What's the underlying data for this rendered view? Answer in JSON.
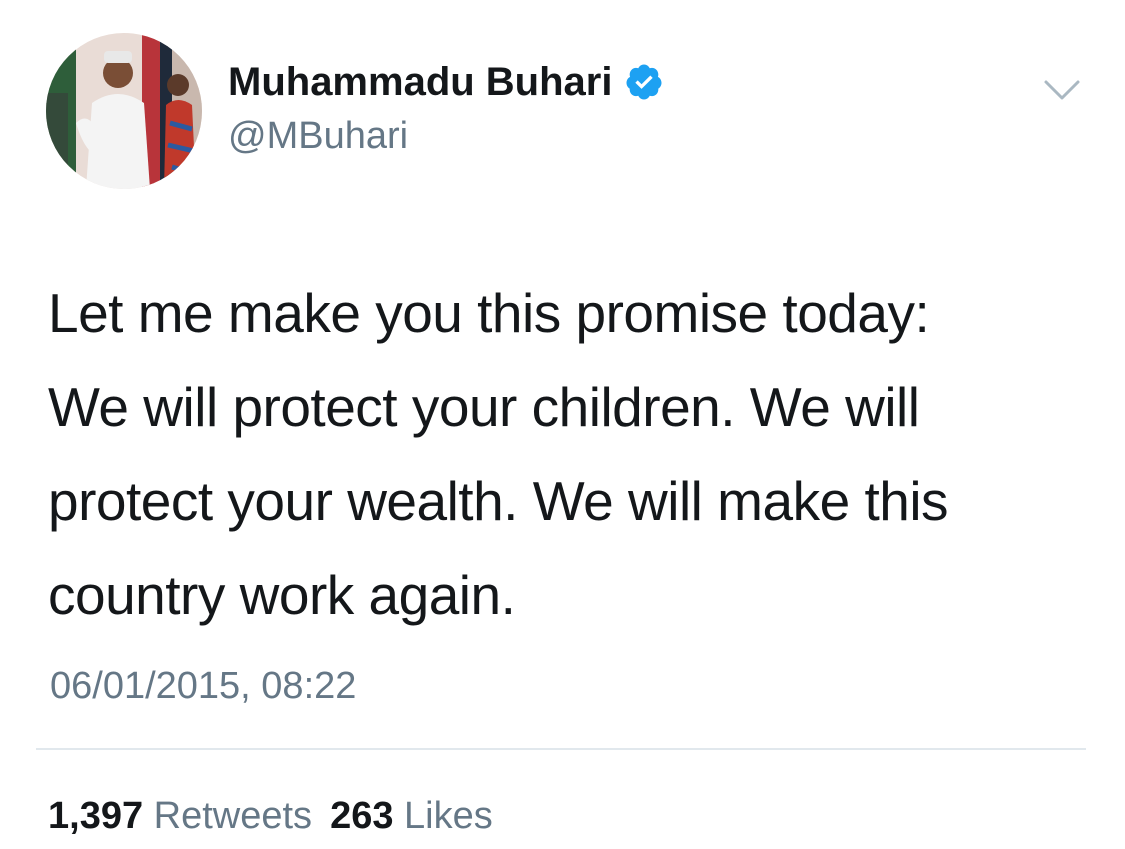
{
  "user": {
    "display_name": "Muhammadu Buhari",
    "handle": "@MBuhari",
    "verified": true,
    "avatar_icon": "profile-photo"
  },
  "tweet": {
    "lines": [
      "Let me make you this promise today:",
      "We will protect your children. We will",
      "protect your wealth. We will make this",
      "country work again."
    ],
    "timestamp": "06/01/2015, 08:22"
  },
  "stats": {
    "retweets_count": "1,397",
    "retweets_label": "Retweets",
    "likes_count": "263",
    "likes_label": "Likes"
  },
  "icons": {
    "menu": "chevron-down-icon",
    "verified": "verified-badge-icon"
  },
  "colors": {
    "text_primary": "#14171a",
    "text_secondary": "#657786",
    "verified_blue": "#1da1f2",
    "divider": "#e1e8ed",
    "chevron": "#aab8c2"
  }
}
